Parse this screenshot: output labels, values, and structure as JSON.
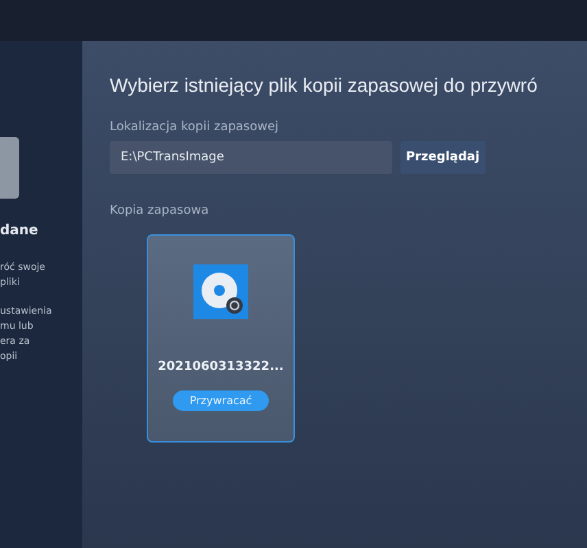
{
  "sidebar": {
    "heading": "dane",
    "lines": [
      "róć swoje",
      "pliki"
    ],
    "lines_2": [
      "ustawienia",
      "mu lub",
      "era za",
      "opii"
    ]
  },
  "title": "Wybierz istniejący plik kopii zapasowej do przywró",
  "location": {
    "label": "Lokalizacja kopii zapasowej",
    "value": "E:\\PCTransImage",
    "browse": "Przeglądaj"
  },
  "backups": {
    "label": "Kopia zapasowa",
    "items": [
      {
        "name": "2021060313322...",
        "action": "Przywracać",
        "selected": true
      }
    ]
  }
}
